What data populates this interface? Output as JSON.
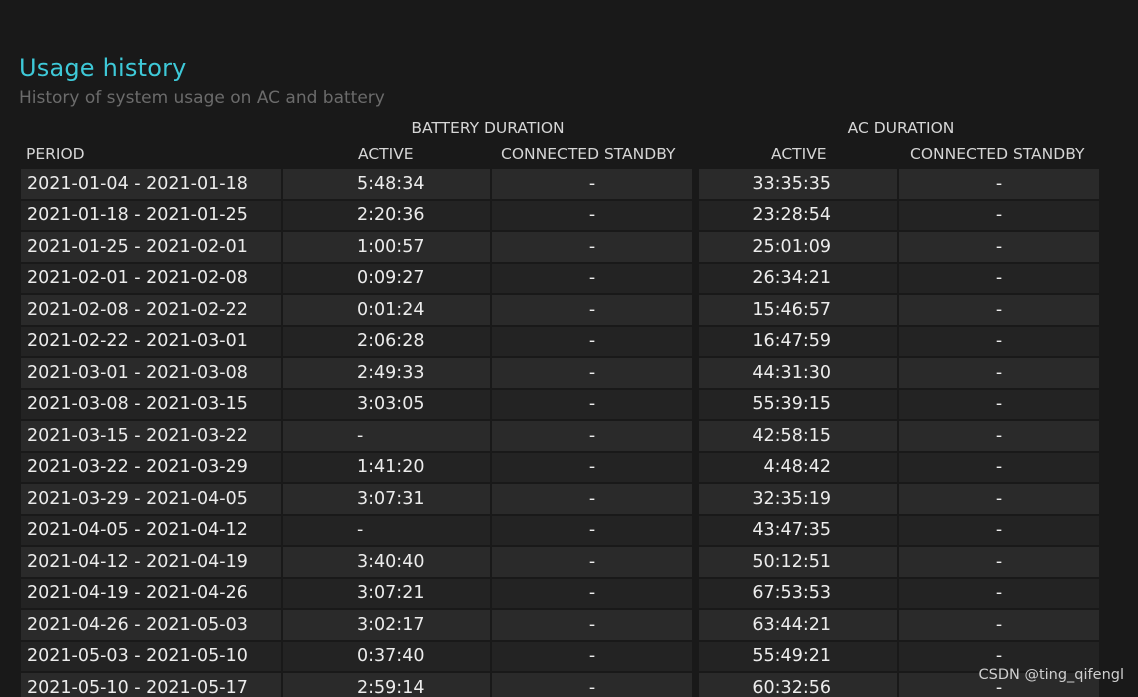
{
  "title": "Usage history",
  "subtitle": "History of system usage on AC and battery",
  "groups": {
    "battery": "BATTERY DURATION",
    "ac": "AC DURATION"
  },
  "columns": {
    "period": "PERIOD",
    "battery_active": "ACTIVE",
    "battery_standby": "CONNECTED STANDBY",
    "ac_active": "ACTIVE",
    "ac_standby": "CONNECTED STANDBY"
  },
  "rows": [
    {
      "period": "2021-01-04 - 2021-01-18",
      "battery_active": "5:48:34",
      "battery_standby": "-",
      "ac_active": "33:35:35",
      "ac_standby": "-"
    },
    {
      "period": "2021-01-18 - 2021-01-25",
      "battery_active": "2:20:36",
      "battery_standby": "-",
      "ac_active": "23:28:54",
      "ac_standby": "-"
    },
    {
      "period": "2021-01-25 - 2021-02-01",
      "battery_active": "1:00:57",
      "battery_standby": "-",
      "ac_active": "25:01:09",
      "ac_standby": "-"
    },
    {
      "period": "2021-02-01 - 2021-02-08",
      "battery_active": "0:09:27",
      "battery_standby": "-",
      "ac_active": "26:34:21",
      "ac_standby": "-"
    },
    {
      "period": "2021-02-08 - 2021-02-22",
      "battery_active": "0:01:24",
      "battery_standby": "-",
      "ac_active": "15:46:57",
      "ac_standby": "-"
    },
    {
      "period": "2021-02-22 - 2021-03-01",
      "battery_active": "2:06:28",
      "battery_standby": "-",
      "ac_active": "16:47:59",
      "ac_standby": "-"
    },
    {
      "period": "2021-03-01 - 2021-03-08",
      "battery_active": "2:49:33",
      "battery_standby": "-",
      "ac_active": "44:31:30",
      "ac_standby": "-"
    },
    {
      "period": "2021-03-08 - 2021-03-15",
      "battery_active": "3:03:05",
      "battery_standby": "-",
      "ac_active": "55:39:15",
      "ac_standby": "-"
    },
    {
      "period": "2021-03-15 - 2021-03-22",
      "battery_active": "-",
      "battery_standby": "-",
      "ac_active": "42:58:15",
      "ac_standby": "-"
    },
    {
      "period": "2021-03-22 - 2021-03-29",
      "battery_active": "1:41:20",
      "battery_standby": "-",
      "ac_active": "4:48:42",
      "ac_standby": "-"
    },
    {
      "period": "2021-03-29 - 2021-04-05",
      "battery_active": "3:07:31",
      "battery_standby": "-",
      "ac_active": "32:35:19",
      "ac_standby": "-"
    },
    {
      "period": "2021-04-05 - 2021-04-12",
      "battery_active": "-",
      "battery_standby": "-",
      "ac_active": "43:47:35",
      "ac_standby": "-"
    },
    {
      "period": "2021-04-12 - 2021-04-19",
      "battery_active": "3:40:40",
      "battery_standby": "-",
      "ac_active": "50:12:51",
      "ac_standby": "-"
    },
    {
      "period": "2021-04-19 - 2021-04-26",
      "battery_active": "3:07:21",
      "battery_standby": "-",
      "ac_active": "67:53:53",
      "ac_standby": "-"
    },
    {
      "period": "2021-04-26 - 2021-05-03",
      "battery_active": "3:02:17",
      "battery_standby": "-",
      "ac_active": "63:44:21",
      "ac_standby": "-"
    },
    {
      "period": "2021-05-03 - 2021-05-10",
      "battery_active": "0:37:40",
      "battery_standby": "-",
      "ac_active": "55:49:21",
      "ac_standby": "-"
    },
    {
      "period": "2021-05-10 - 2021-05-17",
      "battery_active": "2:59:14",
      "battery_standby": "-",
      "ac_active": "60:32:56",
      "ac_standby": "-"
    }
  ],
  "watermark": "CSDN @ting_qifengl"
}
